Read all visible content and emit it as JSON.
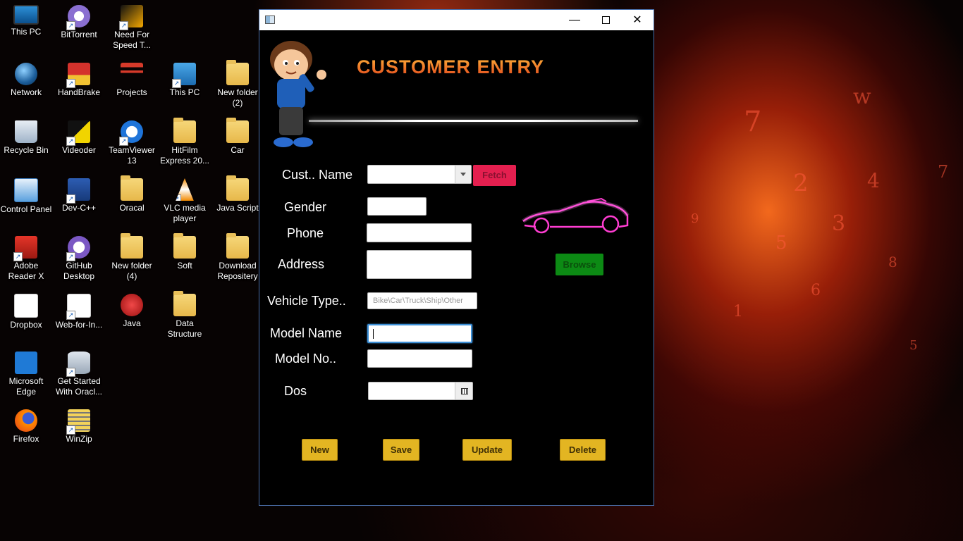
{
  "desktop": {
    "icons": [
      {
        "label": "This PC"
      },
      {
        "label": "BitTorrent"
      },
      {
        "label": "Need For Speed T..."
      },
      {
        "label": "Network"
      },
      {
        "label": "HandBrake"
      },
      {
        "label": "Projects"
      },
      {
        "label": "This PC"
      },
      {
        "label": "New folder (2)"
      },
      {
        "label": "Recycle Bin"
      },
      {
        "label": "Videoder"
      },
      {
        "label": "TeamViewer 13"
      },
      {
        "label": "HitFilm Express 20..."
      },
      {
        "label": "Car"
      },
      {
        "label": "Control Panel"
      },
      {
        "label": "Dev-C++"
      },
      {
        "label": "Oracal"
      },
      {
        "label": "VLC media player"
      },
      {
        "label": "Java Script"
      },
      {
        "label": "Adobe Reader X"
      },
      {
        "label": "GitHub Desktop"
      },
      {
        "label": "New folder (4)"
      },
      {
        "label": "Soft"
      },
      {
        "label": "Download Repositery"
      },
      {
        "label": "Dropbox"
      },
      {
        "label": "Web-for-In..."
      },
      {
        "label": "Java"
      },
      {
        "label": "Data Structure"
      },
      {
        "label": "Microsoft Edge"
      },
      {
        "label": "Get Started With Oracl..."
      },
      {
        "label": "Firefox"
      },
      {
        "label": "WinZip"
      }
    ]
  },
  "window": {
    "controls": {
      "minimize": "—",
      "maximize": "",
      "close": "✕"
    },
    "heading": "CUSTOMER ENTRY",
    "form": {
      "cust_name_label": "Cust.. Name",
      "fetch_button": "Fetch",
      "gender_label": "Gender",
      "phone_label": "Phone",
      "address_label": "Address",
      "browse_button": "Browse",
      "vehicle_type_label": "Vehicle Type..",
      "vehicle_type_placeholder": "Bike\\Car\\Truck\\Ship\\Other",
      "model_name_label": "Model Name",
      "model_no_label": "Model No..",
      "dos_label": "Dos"
    },
    "actions": {
      "new": "New",
      "save": "Save",
      "update": "Update",
      "delete": "Delete"
    }
  },
  "colors": {
    "heading": "#f07a1a",
    "fetch": "#e41f4f",
    "browse": "#0c8a14",
    "action": "#e3b522",
    "car_neon": "#ff3dd2"
  }
}
